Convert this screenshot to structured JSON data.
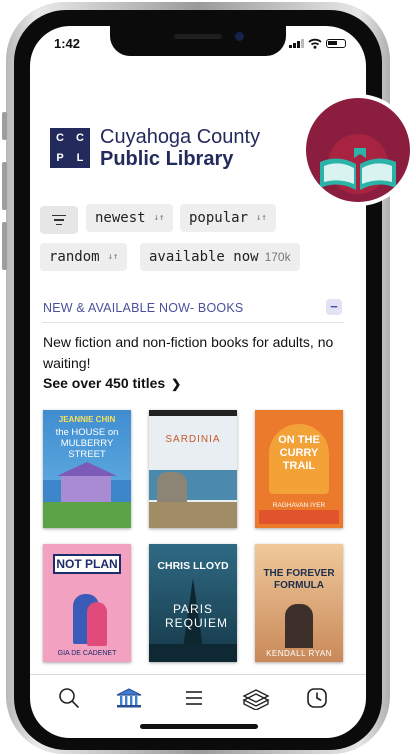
{
  "status_bar": {
    "time": "1:42"
  },
  "library": {
    "logo_letters": [
      "C",
      "C",
      "P",
      "L"
    ],
    "name_line1": "Cuyahoga County",
    "name_line2": "Public Library"
  },
  "sort_chips": [
    {
      "label": "newest"
    },
    {
      "label": "popular"
    },
    {
      "label": "random"
    },
    {
      "label": "available now",
      "count": "170k"
    }
  ],
  "sort_arrows": "↓↑",
  "section": {
    "title": "NEW & AVAILABLE NOW- BOOKS",
    "collapse_symbol": "−",
    "description": "New fiction and non-fiction books for adults, no waiting!",
    "see_all": "See over 450 titles",
    "see_all_chevron": "❯"
  },
  "books": [
    {
      "line1": "JEANNIE CHIN",
      "line2": "the HOUSE on MULBERRY STREET",
      "color": "#3c86c9"
    },
    {
      "line1": "SARDINIA",
      "line2": "",
      "color": "#e9eef3"
    },
    {
      "line1": "ON THE CURRY TRAIL",
      "line2": "RAGHAVAN IYER",
      "color": "#ec7a2c"
    },
    {
      "line1": "NOT PLAN",
      "line2": "GIA DE CADENET",
      "color": "#f2a2c0"
    },
    {
      "line1": "CHRIS LLOYD",
      "line2": "PARIS REQUIEM",
      "color": "#1f4e63"
    },
    {
      "line1": "THE FOREVER FORMULA",
      "line2": "KENDALL RYAN",
      "color": "#e2b079"
    }
  ],
  "tabs": [
    "search-icon",
    "library-icon",
    "menu-icon",
    "shelf-icon",
    "clock-icon"
  ],
  "colors": {
    "accent": "#4b4f9c",
    "brand_navy": "#232a5c",
    "app_icon_bg": "#8b1e3f",
    "app_icon_book": "#2bb3a8"
  }
}
